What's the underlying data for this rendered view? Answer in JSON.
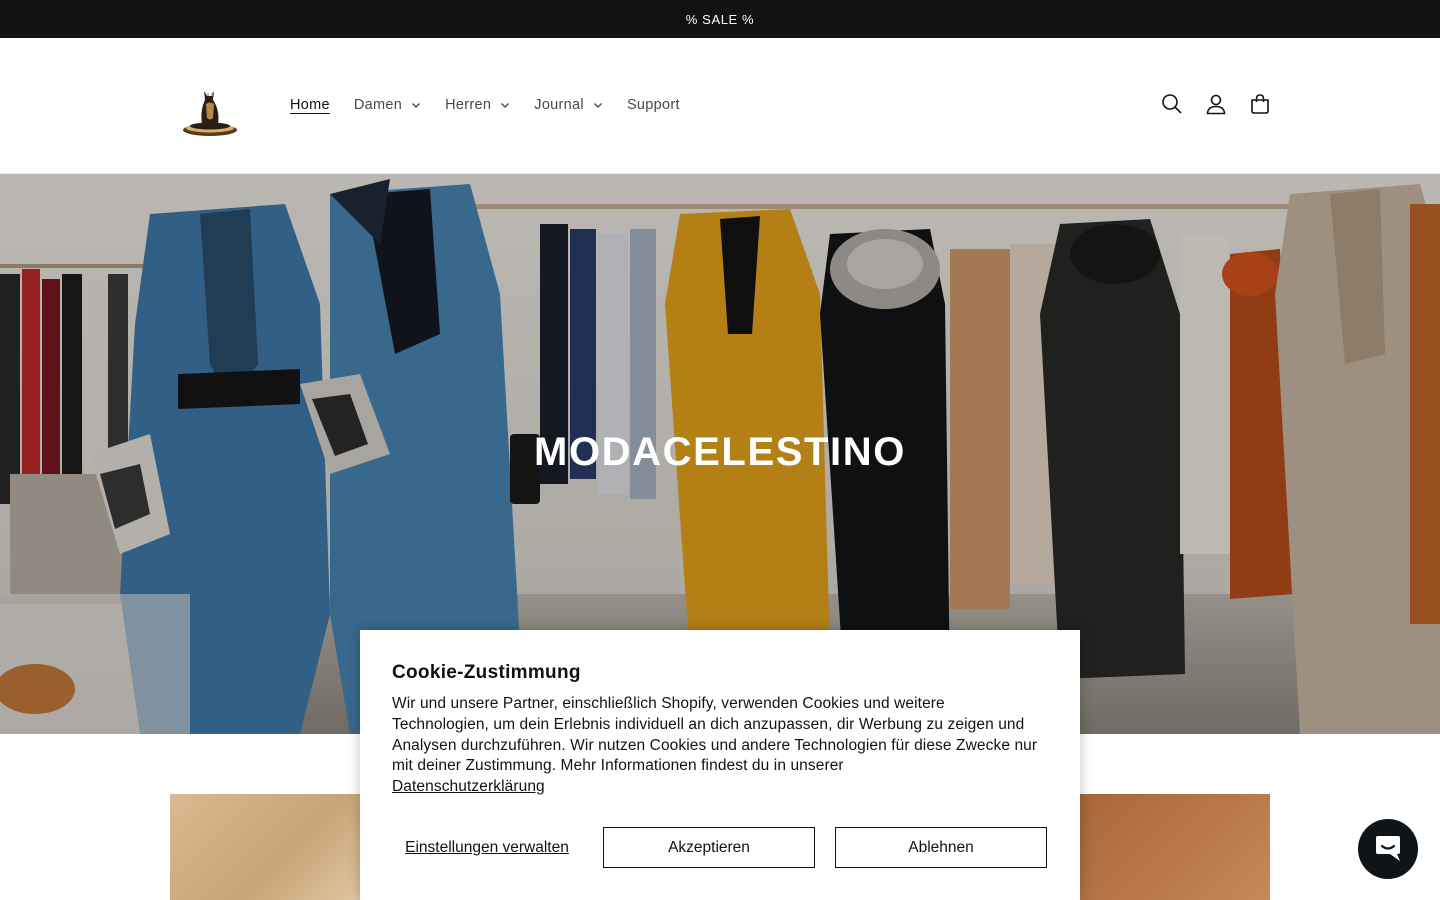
{
  "announcement": {
    "text": "% SALE %"
  },
  "header": {
    "logo_alt": "MODACELESTINO",
    "nav": [
      {
        "label": "Home",
        "active": true,
        "dropdown": false
      },
      {
        "label": "Damen",
        "active": false,
        "dropdown": true
      },
      {
        "label": "Herren",
        "active": false,
        "dropdown": true
      },
      {
        "label": "Journal",
        "active": false,
        "dropdown": true
      },
      {
        "label": "Support",
        "active": false,
        "dropdown": false
      }
    ],
    "icons": [
      "search-icon",
      "account-icon",
      "cart-icon"
    ]
  },
  "hero": {
    "title": "MODACELESTINO"
  },
  "cookie": {
    "title": "Cookie-Zustimmung",
    "text": "Wir und unsere Partner, einschließlich Shopify, verwenden Cookies und weitere Technologien, um dein Erlebnis individuell an dich anzupassen, dir Werbung zu zeigen und Analysen durchzuführen. Wir nutzen Cookies und andere Technologien für diese Zwecke nur mit deiner Zustimmung. Mehr Informationen findest du in unserer",
    "link": "Datenschutzerklärung",
    "manage_label": "Einstellungen verwalten",
    "accept_label": "Akzeptieren",
    "decline_label": "Ablehnen"
  },
  "chat": {
    "icon": "chat-icon"
  },
  "colors": {
    "announcement_bg": "#121212",
    "text": "#121212",
    "chat_bg": "#0f1418"
  }
}
